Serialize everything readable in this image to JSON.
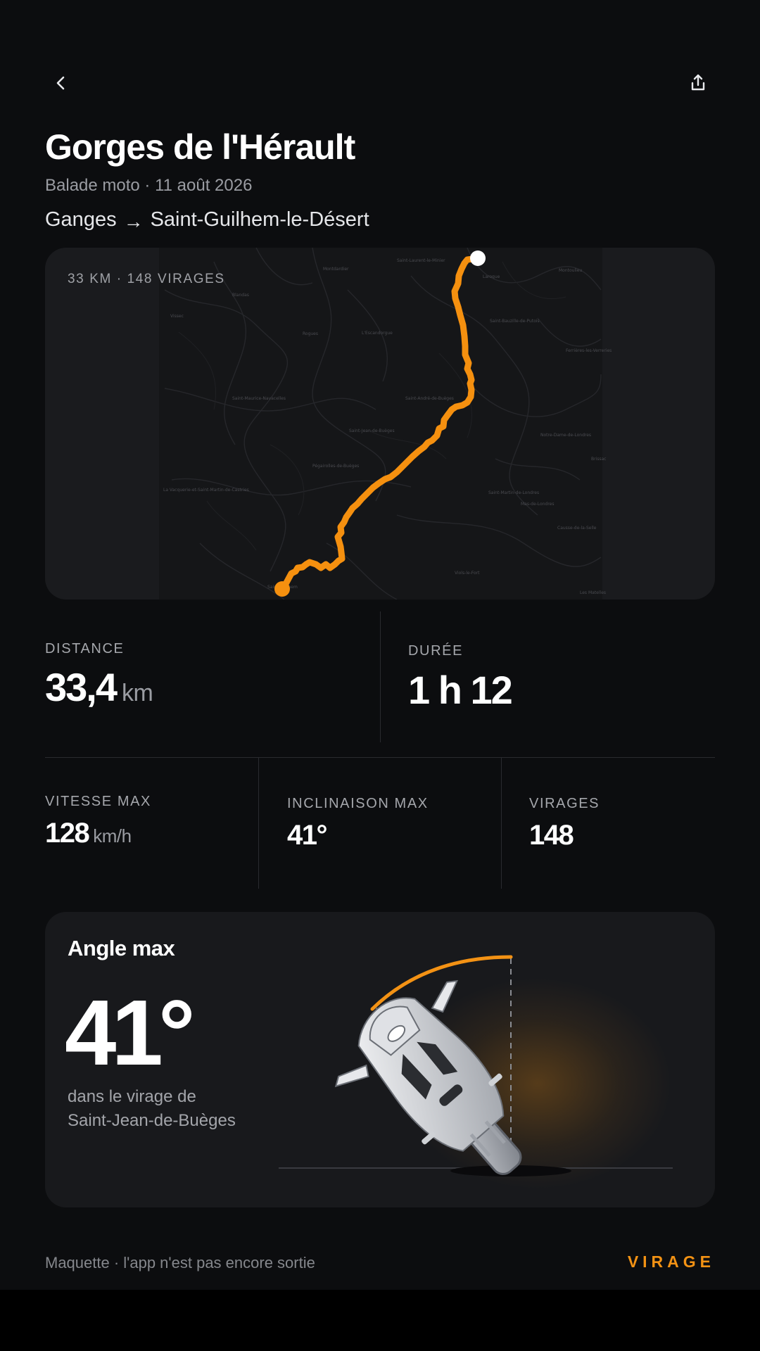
{
  "header": {
    "back_icon": "chevron-left-icon",
    "share_icon": "share-icon",
    "title": "Gorges de l'Hérault",
    "subtitle": "Balade moto · 11 août 2026",
    "route_from": "Ganges",
    "route_arrow": "→",
    "route_to": "Saint-Guilhem-le-Désert"
  },
  "map": {
    "caption": "33 KM · 148 VIRAGES",
    "route_color": "#f5900f",
    "place_labels": [
      "Montdardier",
      "Saint-Laurent-le-Minier",
      "Laroque",
      "Montoulieu",
      "Blandas",
      "Vissec",
      "Rogues",
      "L'Escandorgue",
      "Saint-Bauzille-de-Putois",
      "Ferrières-les-Verreries",
      "Saint-Maurice-Navacelles",
      "Saint-André-de-Buèges",
      "Saint-Jean-de-Buèges",
      "Notre-Dame-de-Londres",
      "Pégairolles-de-Buèges",
      "La Vacquerie-et-Saint-Martin-de-Castries",
      "Saint-Martin-de-Londres",
      "Mas-de-Londres",
      "Causse-de-la-Selle",
      "Viols-le-Fort",
      "Saint-Guilhem",
      "Les Matelles",
      "Brissac"
    ]
  },
  "stats": {
    "distance": {
      "label": "DISTANCE",
      "value": "33,4",
      "unit": "km"
    },
    "duration": {
      "label": "DURÉE",
      "value": "1 h 12"
    },
    "max_speed": {
      "label": "VITESSE MAX",
      "value": "128",
      "unit": "km/h"
    },
    "max_lean": {
      "label": "INCLINAISON MAX",
      "value": "41°"
    },
    "turns": {
      "label": "VIRAGES",
      "value": "148"
    }
  },
  "angle_card": {
    "title": "Angle max",
    "value": "41°",
    "desc_line1": "dans le virage de",
    "desc_line2": "Saint-Jean-de-Buèges",
    "illustration": "motorcycle-lean-icon",
    "accent_color": "#f39214"
  },
  "footer": {
    "note": "Maquette · l'app n'est pas encore sortie",
    "brand": "VIRAGE"
  }
}
